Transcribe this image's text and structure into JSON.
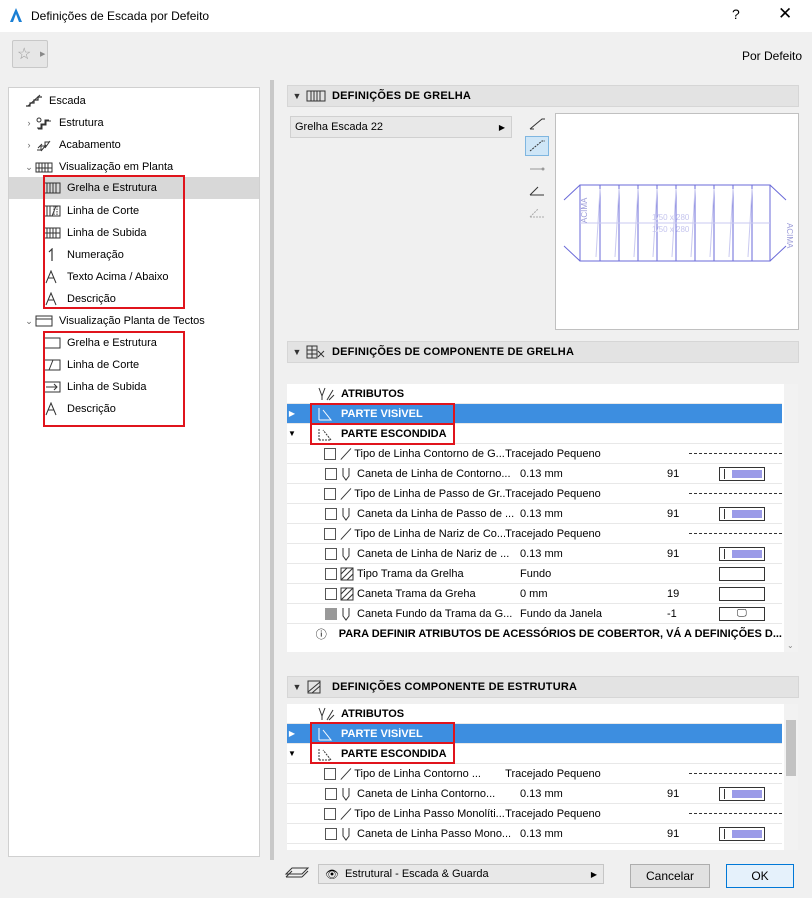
{
  "window": {
    "title": "Definições de Escada por Defeito",
    "help": "?",
    "close": "✕"
  },
  "toolbar": {
    "default_label": "Por Defeito"
  },
  "tree": [
    {
      "label": "Escada",
      "level": 0,
      "arrow": ""
    },
    {
      "label": "Estrutura",
      "level": 1,
      "arrow": "›"
    },
    {
      "label": "Acabamento",
      "level": 1,
      "arrow": "›"
    },
    {
      "label": "Visualização em Planta",
      "level": 1,
      "arrow": "⌄"
    },
    {
      "label": "Grelha e Estrutura",
      "level": 2,
      "selected": true
    },
    {
      "label": "Linha de Corte",
      "level": 2
    },
    {
      "label": "Linha de Subida",
      "level": 2
    },
    {
      "label": "Numeração",
      "level": 2
    },
    {
      "label": "Texto Acima / Abaixo",
      "level": 2
    },
    {
      "label": "Descrição",
      "level": 2
    },
    {
      "label": "Visualização Planta de Tectos",
      "level": 1,
      "arrow": "⌄"
    },
    {
      "label": "Grelha e Estrutura",
      "level": 2
    },
    {
      "label": "Linha de Corte",
      "level": 2
    },
    {
      "label": "Linha de Subida",
      "level": 2
    },
    {
      "label": "Descrição",
      "level": 2
    }
  ],
  "grid_section": {
    "title": "DEFINIÇÕES DE GRELHA",
    "dropdown": "Grelha Escada 22",
    "preview_left": "ACIMA",
    "preview_right": "ACIMA",
    "preview_mid1": "1/50 x 280",
    "preview_mid2": "1/50 x 280"
  },
  "comp_section": {
    "title": "DEFINIÇÕES DE COMPONENTE DE GRELHA",
    "attrs": "ATRIBUTOS",
    "visible": "PARTE VISÍVEL",
    "hidden": "PARTE ESCONDIDA",
    "rows": [
      {
        "name": "Tipo de Linha Contorno de G...",
        "value": "Tracejado Pequeno",
        "num": "",
        "kind": "dash"
      },
      {
        "name": "Caneta de Linha de Contorno...",
        "value": "0.13 mm",
        "num": "91",
        "kind": "pen"
      },
      {
        "name": "Tipo de Linha de Passo de Gr...",
        "value": "Tracejado Pequeno",
        "num": "",
        "kind": "dash"
      },
      {
        "name": "Caneta da Linha de Passo de ...",
        "value": "0.13 mm",
        "num": "91",
        "kind": "pen"
      },
      {
        "name": "Tipo de Linha de Nariz de Co...",
        "value": "Tracejado Pequeno",
        "num": "",
        "kind": "dash"
      },
      {
        "name": "Caneta de Linha de Nariz de ...",
        "value": "0.13 mm",
        "num": "91",
        "kind": "pen"
      },
      {
        "name": "Tipo Trama da Grelha",
        "value": "Fundo",
        "num": "",
        "kind": "box"
      },
      {
        "name": "Caneta Trama da Greha",
        "value": "0 mm",
        "num": "19",
        "kind": "box"
      },
      {
        "name": "Caneta Fundo da Trama da G...",
        "value": "Fundo da Janela",
        "num": "-1",
        "kind": "monitor"
      }
    ],
    "info": "PARA DEFINIR ATRIBUTOS DE ACESSÓRIOS DE COBERTOR, VÁ A DEFINIÇÕES D..."
  },
  "struct_section": {
    "title": "DEFINIÇÕES COMPONENTE DE ESTRUTURA",
    "attrs": "ATRIBUTOS",
    "visible": "PARTE VISÍVEL",
    "hidden": "PARTE ESCONDIDA",
    "rows": [
      {
        "name": "Tipo de Linha Contorno ...",
        "value": "Tracejado Pequeno",
        "num": "",
        "kind": "dash"
      },
      {
        "name": "Caneta de Linha Contorno...",
        "value": "0.13 mm",
        "num": "91",
        "kind": "pen"
      },
      {
        "name": "Tipo de Linha Passo Monolíti...",
        "value": "Tracejado Pequeno",
        "num": "",
        "kind": "dash"
      },
      {
        "name": "Caneta de Linha Passo Mono...",
        "value": "0.13 mm",
        "num": "91",
        "kind": "pen"
      }
    ]
  },
  "footer": {
    "layer": "Estrutural - Escada & Guarda",
    "cancel": "Cancelar",
    "ok": "OK"
  },
  "colors": {
    "selection": "#3d8ee0",
    "redbox": "#e0141c",
    "pen_swatch": "#9b9be8",
    "preview_lines": "#6a6ad8"
  }
}
